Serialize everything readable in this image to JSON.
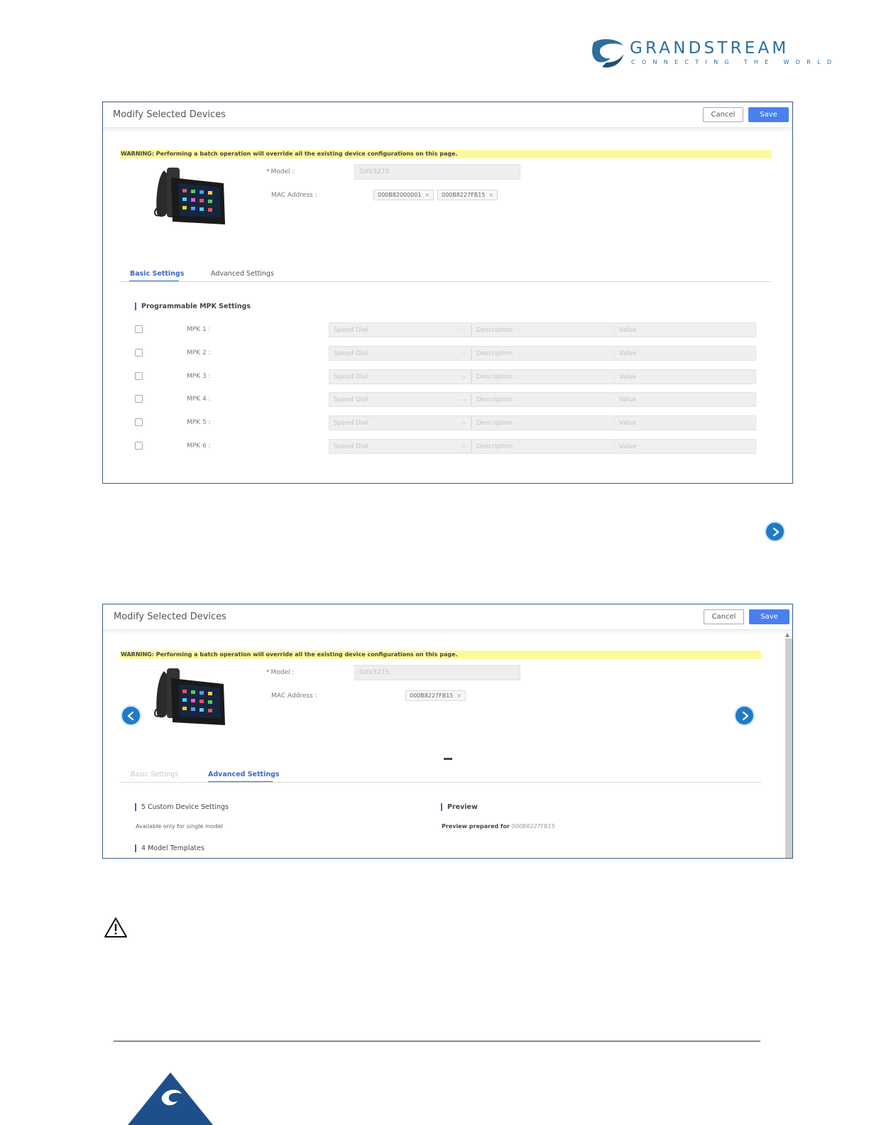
{
  "logo": {
    "brand": "GRANDSTREAM",
    "tagline": "CONNECTING THE WORLD",
    "icon": "grandstream-logo-icon"
  },
  "dialog1": {
    "title": "Modify Selected Devices",
    "cancel_label": "Cancel",
    "save_label": "Save",
    "warning": "WARNING: Performing a batch operation will override all the existing device configurations on this page.",
    "model_label": "Model :",
    "model_value": "GXV3275",
    "mac_label": "MAC Address :",
    "mac_tags": [
      "000B82000001",
      "000B8227FB15"
    ],
    "tabs": [
      {
        "label": "Basic Settings",
        "active": true
      },
      {
        "label": "Advanced Settings",
        "active": false
      }
    ],
    "section_title": "Programmable MPK Settings",
    "mpk_rows": [
      {
        "label": "MPK 1 :",
        "type": "Speed Dial",
        "description": "Description",
        "value": "Value"
      },
      {
        "label": "MPK 2 :",
        "type": "Speed Dial",
        "description": "Description",
        "value": "Value"
      },
      {
        "label": "MPK 3 :",
        "type": "Speed Dial",
        "description": "Description",
        "value": "Value"
      },
      {
        "label": "MPK 4 :",
        "type": "Speed Dial",
        "description": "Description",
        "value": "Value"
      },
      {
        "label": "MPK 5 :",
        "type": "Speed Dial",
        "description": "Description",
        "value": "Value"
      },
      {
        "label": "MPK 6 :",
        "type": "Speed Dial",
        "description": "Description",
        "value": "Value"
      }
    ]
  },
  "dialog2": {
    "title": "Modify Selected Devices",
    "cancel_label": "Cancel",
    "save_label": "Save",
    "warning": "WARNING: Performing a batch operation will override all the existing device configurations on this page.",
    "model_label": "Model :",
    "model_value": "GXV3275",
    "mac_label": "MAC Address :",
    "mac_tags": [
      "000B8227FB15"
    ],
    "tabs": [
      {
        "label": "Basic Settings",
        "active": false
      },
      {
        "label": "Advanced Settings",
        "active": true
      }
    ],
    "custom_section": "5 Custom Device Settings",
    "custom_note": "Available only for single model",
    "preview_section": "Preview",
    "preview_prefix": "Preview prepared for",
    "preview_mac": "000B8227FB15",
    "templates_section": "4 Model Templates"
  },
  "colors": {
    "accent": "#3f67c7",
    "save_button": "#4a7ff0",
    "warning_bg": "#fdfa9c",
    "nav_circle": "#1f7bc8",
    "brand": "#2c6e9e"
  }
}
